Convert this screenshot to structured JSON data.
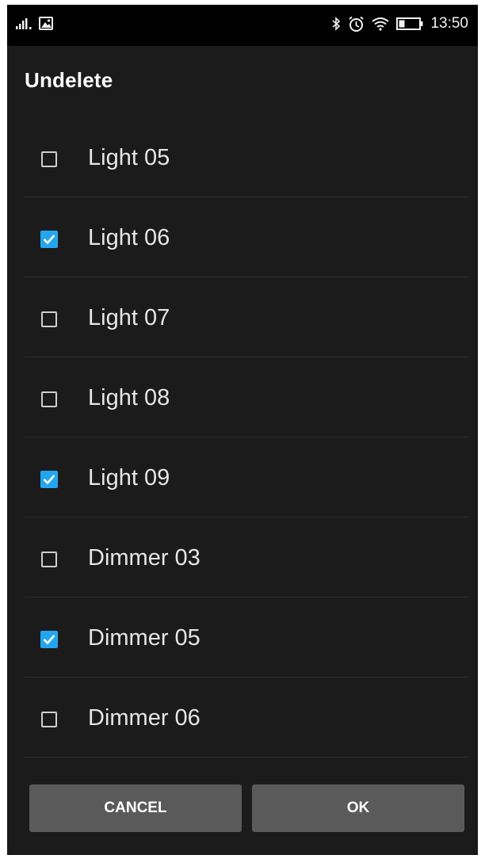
{
  "status_bar": {
    "time": "13:50",
    "icons": [
      "signal-icon",
      "image-notification-icon",
      "bluetooth-icon",
      "alarm-icon",
      "wifi-icon",
      "battery-icon"
    ]
  },
  "dialog": {
    "title": "Undelete",
    "items": [
      {
        "label": "Light 05",
        "checked": false
      },
      {
        "label": "Light 06",
        "checked": true
      },
      {
        "label": "Light 07",
        "checked": false
      },
      {
        "label": "Light 08",
        "checked": false
      },
      {
        "label": "Light 09",
        "checked": true
      },
      {
        "label": "Dimmer 03",
        "checked": false
      },
      {
        "label": "Dimmer 05",
        "checked": true
      },
      {
        "label": "Dimmer 06",
        "checked": false
      }
    ],
    "cancel_label": "CANCEL",
    "ok_label": "OK"
  },
  "colors": {
    "background": "#1b1b1b",
    "status_bar": "#000000",
    "accent": "#24a6ee",
    "button": "#5a5a5a",
    "divider": "#2e2e2e"
  }
}
